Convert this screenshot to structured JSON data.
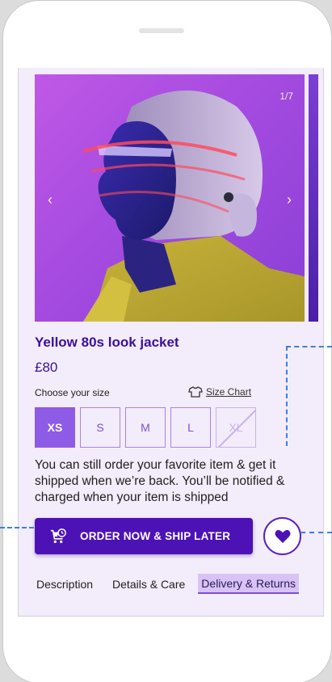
{
  "carousel": {
    "counter": "1/7",
    "prev_arrow": "‹",
    "next_arrow": "›",
    "image_icon": "product-photo"
  },
  "product": {
    "title": "Yellow 80s look jacket",
    "price": "£80"
  },
  "size": {
    "label": "Choose your size",
    "chart_label": "Size Chart",
    "chart_icon": "tshirt-icon",
    "options": [
      {
        "label": "XS",
        "state": "selected"
      },
      {
        "label": "S",
        "state": "available"
      },
      {
        "label": "M",
        "state": "available"
      },
      {
        "label": "L",
        "state": "available"
      },
      {
        "label": "XL",
        "state": "unavailable"
      }
    ]
  },
  "notice": "You can still order your favorite item & get it shipped when we’re back. You’ll be notified & charged when your item is shipped",
  "actions": {
    "order_label": "ORDER NOW & SHIP LATER",
    "order_icon": "cart-clock-icon",
    "wishlist_icon": "heart-icon"
  },
  "tabs": [
    {
      "label": "Description",
      "active": false
    },
    {
      "label": "Details & Care",
      "active": false
    },
    {
      "label": "Delivery & Returns",
      "active": true
    }
  ],
  "colors": {
    "brand": "#4d12b6",
    "accent": "#8e5be6",
    "title": "#3b0f9e",
    "background": "#f3ecfa",
    "annotation": "#3f7fe0"
  }
}
